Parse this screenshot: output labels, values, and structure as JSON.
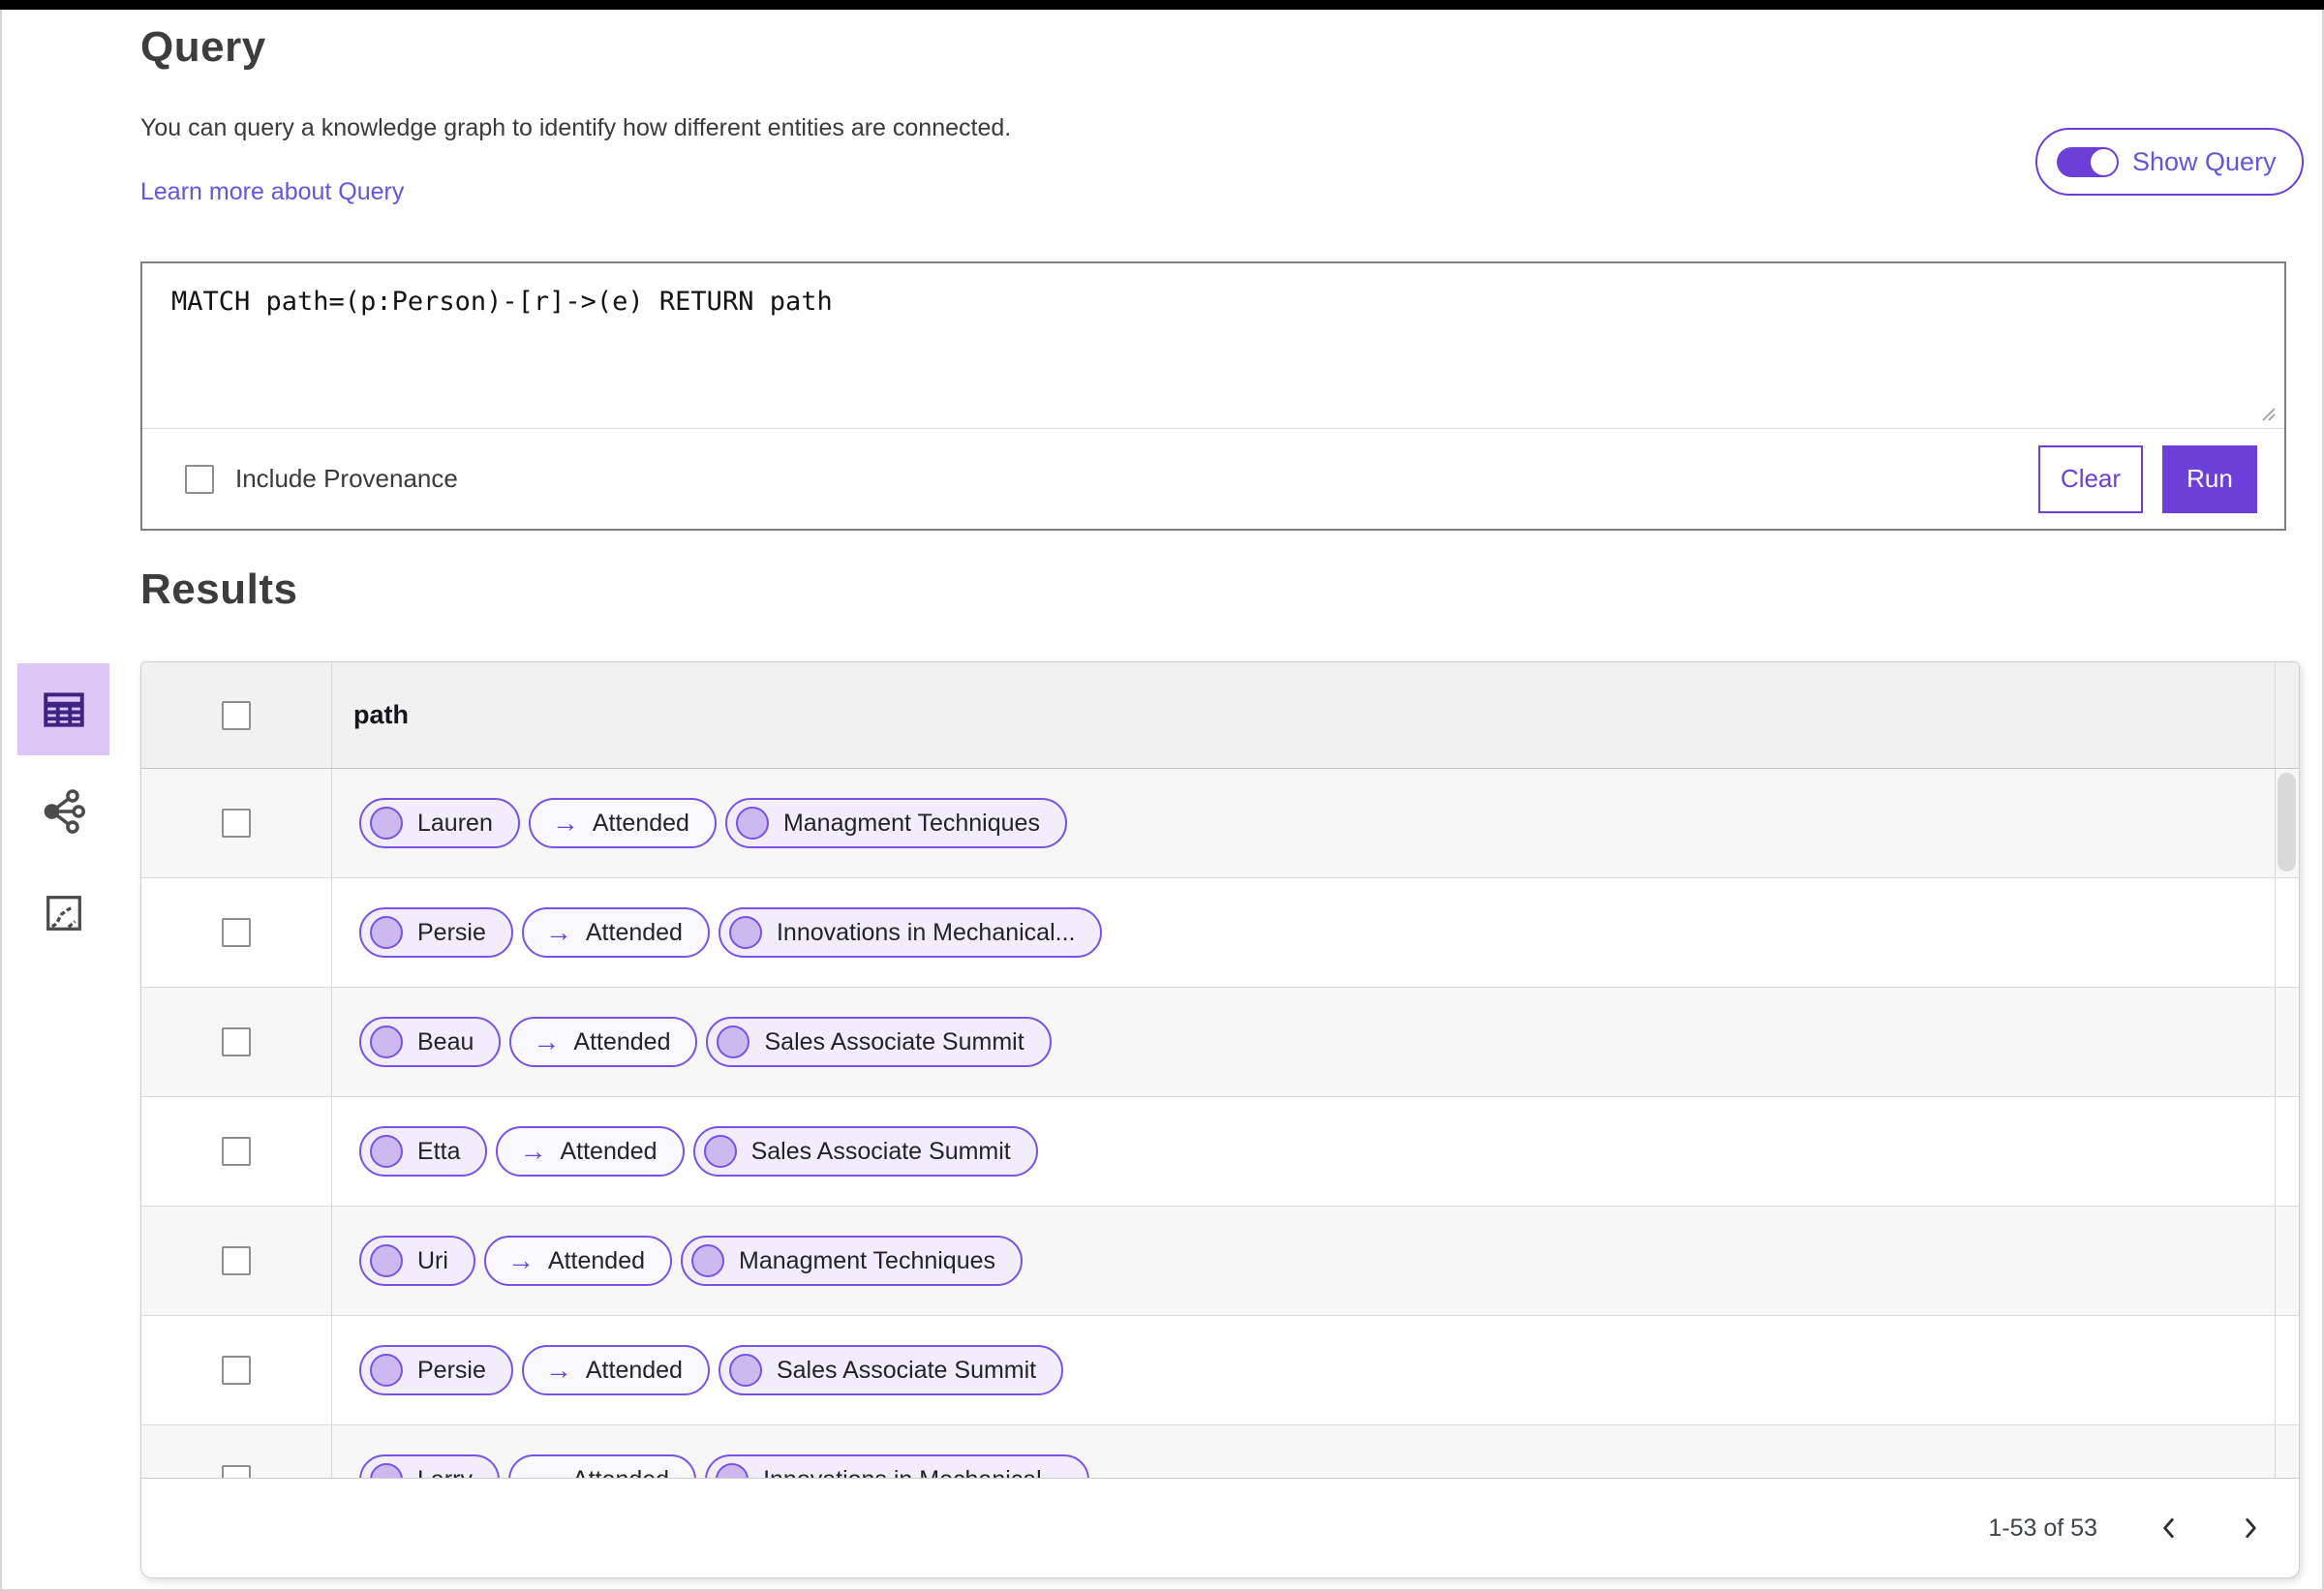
{
  "header": {
    "title": "Query",
    "description": "You can query a knowledge graph to identify how different entities are connected.",
    "learn_more_link": "Learn more about Query",
    "show_query": {
      "label": "Show Query",
      "state": "on"
    }
  },
  "query_editor": {
    "query_text": "MATCH path=(p:Person)-[r]->(e) RETURN path",
    "include_provenance_label": "Include Provenance",
    "include_provenance_checked": false,
    "clear_button": "Clear",
    "run_button": "Run"
  },
  "results": {
    "title": "Results",
    "view_switcher": [
      {
        "name": "table-view",
        "icon": "table-icon",
        "selected": true
      },
      {
        "name": "graph-view",
        "icon": "graph-icon",
        "selected": false
      },
      {
        "name": "chart-view",
        "icon": "chart-icon",
        "selected": false
      }
    ],
    "table": {
      "column_header": "path",
      "edge_arrow": "→",
      "rows": [
        {
          "node": "Lauren",
          "edge": "Attended",
          "target": "Managment Techniques"
        },
        {
          "node": "Persie",
          "edge": "Attended",
          "target": "Innovations in Mechanical..."
        },
        {
          "node": "Beau",
          "edge": "Attended",
          "target": "Sales Associate Summit"
        },
        {
          "node": "Etta",
          "edge": "Attended",
          "target": "Sales Associate Summit"
        },
        {
          "node": "Uri",
          "edge": "Attended",
          "target": "Managment Techniques"
        },
        {
          "node": "Persie",
          "edge": "Attended",
          "target": "Sales Associate Summit"
        },
        {
          "node": "Larry",
          "edge": "Attended",
          "target": "Innovations in Mechanical..."
        }
      ]
    },
    "pagination": {
      "range_label": "1-53 of 53"
    }
  },
  "colors": {
    "primary_purple": "#6c3fd8",
    "link_purple": "#6156e0",
    "pill_border": "#7a52e8",
    "pill_node_bg": "#f1edfb",
    "pill_edge_bg": "#f9f8fd",
    "node_circle_fill": "#cbb9f0",
    "selected_view_bg": "#dcc8f7",
    "selected_view_icon": "#3d2483",
    "topbar": "#000000"
  }
}
